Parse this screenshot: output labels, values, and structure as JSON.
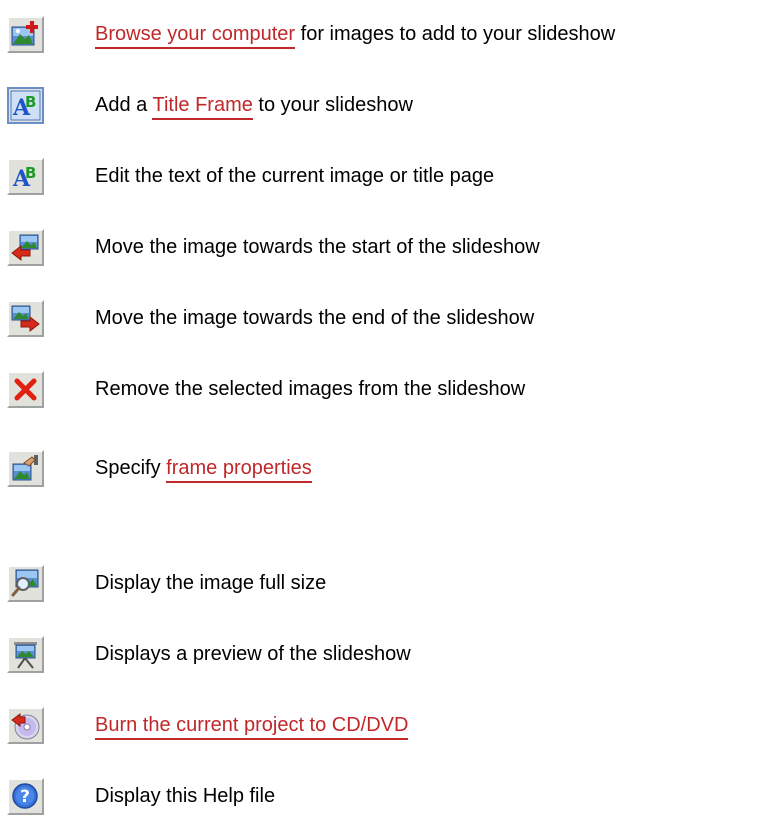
{
  "items": [
    {
      "icon": "add-image-icon",
      "link": "Browse your computer",
      "post": " for images to add to your slideshow"
    },
    {
      "icon": "title-frame-icon",
      "pre": "Add a ",
      "link": "Title Frame",
      "post": " to your slideshow"
    },
    {
      "icon": "edit-text-icon",
      "text": "Edit the text of the current image or title page"
    },
    {
      "icon": "move-left-icon",
      "text": "Move the image towards the start of the slideshow"
    },
    {
      "icon": "move-right-icon",
      "text": "Move the image towards the end of the slideshow"
    },
    {
      "icon": "remove-icon",
      "text": "Remove the selected images from the slideshow"
    },
    {
      "icon": "frame-properties-icon",
      "pre": "Specify ",
      "link": "frame properties"
    },
    {
      "icon": "zoom-image-icon",
      "text": "Display the image full size"
    },
    {
      "icon": "preview-slideshow-icon",
      "text": "Displays a preview of the slideshow"
    },
    {
      "icon": "burn-disc-icon",
      "link": "Burn the current project to CD/DVD"
    },
    {
      "icon": "help-icon",
      "text": "Display this Help file"
    }
  ],
  "colors": {
    "link": "#c0282a",
    "button_face": "#e2e2dc"
  }
}
